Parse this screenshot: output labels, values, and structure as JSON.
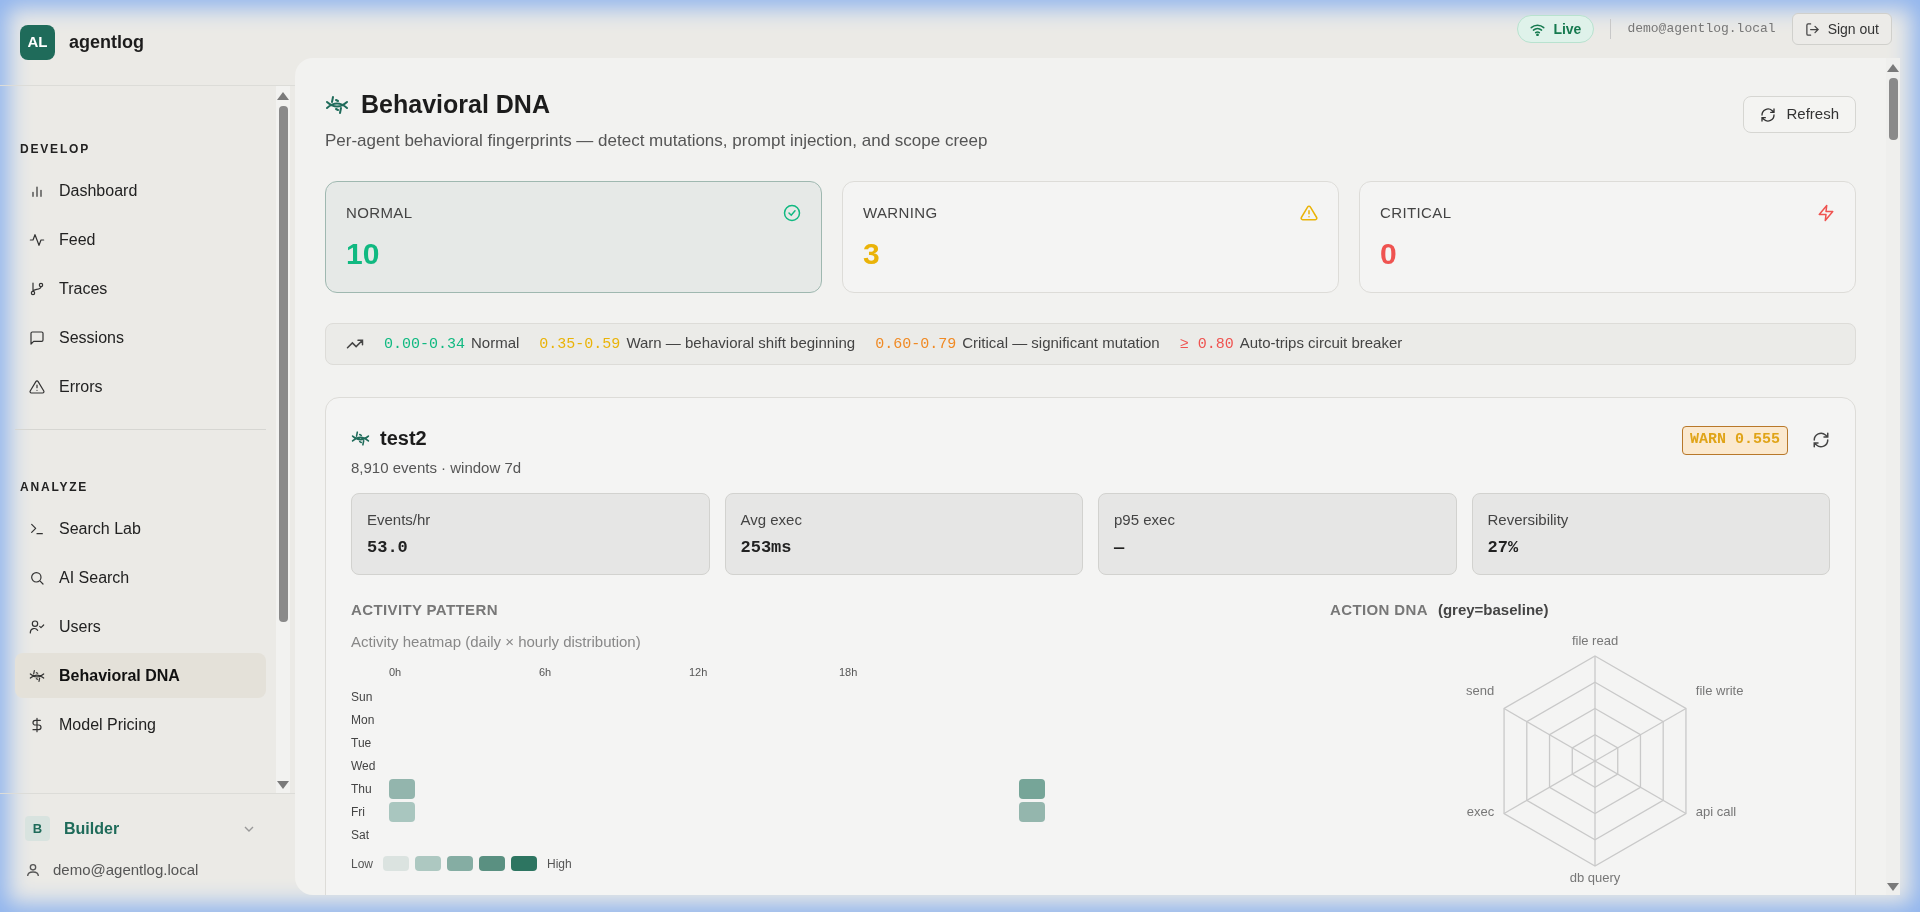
{
  "brand": {
    "initials": "AL",
    "name": "agentlog"
  },
  "sidebar": {
    "sections": [
      {
        "title": "DEVELOP",
        "items": [
          {
            "label": "Dashboard",
            "kind": "bars",
            "selected": false
          },
          {
            "label": "Feed",
            "kind": "pulse",
            "selected": false
          },
          {
            "label": "Traces",
            "kind": "branch",
            "selected": false
          },
          {
            "label": "Sessions",
            "kind": "message",
            "selected": false
          },
          {
            "label": "Errors",
            "kind": "alert",
            "selected": false
          }
        ]
      },
      {
        "title": "ANALYZE",
        "items": [
          {
            "label": "Search Lab",
            "kind": "terminal",
            "selected": false
          },
          {
            "label": "AI Search",
            "kind": "search",
            "selected": false
          },
          {
            "label": "Users",
            "kind": "user",
            "selected": false
          },
          {
            "label": "Behavioral DNA",
            "kind": "dna",
            "selected": true
          },
          {
            "label": "Model Pricing",
            "kind": "dollar",
            "selected": false
          }
        ]
      }
    ],
    "workspace": {
      "initial": "B",
      "name": "Builder"
    },
    "user": "demo@agentlog.local"
  },
  "topbar": {
    "live": "Live",
    "email": "demo@agentlog.local",
    "sign_out": "Sign out"
  },
  "page": {
    "title": "Behavioral DNA",
    "subtitle": "Per-agent behavioral fingerprints — detect mutations, prompt injection, and scope creep",
    "refresh": "Refresh"
  },
  "stats": [
    {
      "kind": "normal",
      "label": "NORMAL",
      "value": "10",
      "selected": true
    },
    {
      "kind": "warning",
      "label": "WARNING",
      "value": "3",
      "selected": false
    },
    {
      "kind": "critical",
      "label": "CRITICAL",
      "value": "0",
      "selected": false
    }
  ],
  "thresholds": [
    {
      "kind": "normal",
      "range": "0.00-0.34",
      "text": "Normal"
    },
    {
      "kind": "warning",
      "range": "0.35-0.59",
      "text": "Warn — behavioral shift beginning"
    },
    {
      "kind": "critical",
      "range": "0.60-0.79",
      "text": "Critical — significant mutation"
    },
    {
      "kind": "trip",
      "range": "≥ 0.80",
      "text": "Auto-trips circuit breaker"
    }
  ],
  "agent": {
    "name": "test2",
    "meta": "8,910 events · window 7d",
    "badge": "WARN 0.555",
    "metrics": [
      {
        "label": "Events/hr",
        "value": "53.0"
      },
      {
        "label": "Avg exec",
        "value": "253ms"
      },
      {
        "label": "p95 exec",
        "value": "—"
      },
      {
        "label": "Reversibility",
        "value": "27%"
      }
    ],
    "activity": {
      "title": "ACTIVITY PATTERN",
      "caption": "Activity heatmap (daily × hourly distribution)",
      "hour_labels": [
        "0h",
        "6h",
        "12h",
        "18h"
      ],
      "rows": [
        {
          "day": "Sun"
        },
        {
          "day": "Mon"
        },
        {
          "day": "Tue"
        },
        {
          "day": "Wed"
        },
        {
          "day": "Thu",
          "cells": [
            {
              "color": "#93b5ad"
            },
            null,
            null,
            null,
            null,
            null,
            null,
            null,
            null,
            null,
            null,
            null,
            null,
            null,
            null,
            null,
            null,
            null,
            null,
            null,
            null,
            null,
            null,
            {
              "color": "#76a598"
            }
          ]
        },
        {
          "day": "Fri",
          "cells": [
            {
              "color": "#a9c6bf"
            },
            null,
            null,
            null,
            null,
            null,
            null,
            null,
            null,
            null,
            null,
            null,
            null,
            null,
            null,
            null,
            null,
            null,
            null,
            null,
            null,
            null,
            null,
            {
              "color": "#94b6ad"
            }
          ]
        },
        {
          "day": "Sat"
        }
      ],
      "legend": {
        "low": "Low",
        "high": "High",
        "swatches": [
          {
            "color": "#dbe3e0"
          },
          {
            "color": "#adc8c1"
          },
          {
            "color": "#85ada3"
          },
          {
            "color": "#5a9081"
          },
          {
            "color": "#2d7561"
          }
        ]
      }
    },
    "action_dna": {
      "title": "ACTION DNA",
      "note": "(grey=baseline)",
      "axes": [
        "file read",
        "file write",
        "api call",
        "db query",
        "exec",
        "send"
      ]
    }
  }
}
